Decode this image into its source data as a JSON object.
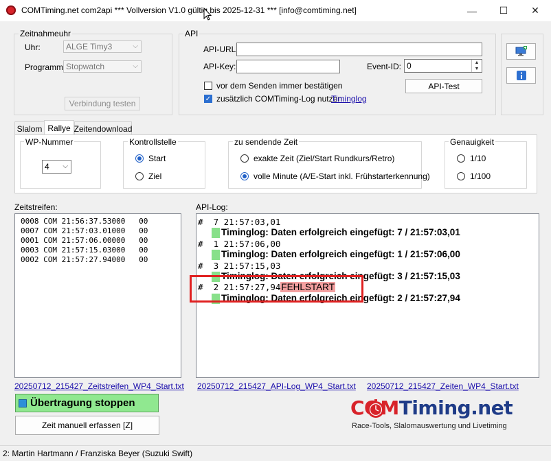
{
  "window": {
    "title": "COMTiming.net com2api *** Vollversion V1.0 gültig bis 2025-12-31 *** [info@comtiming.net]",
    "minimize": "—",
    "maximize": "☐",
    "close": "✕"
  },
  "zeitnahmeuhr": {
    "legend": "Zeitnahmeuhr",
    "uhr_label": "Uhr:",
    "uhr_value": "ALGE Timy3",
    "programm_label": "Programm:",
    "programm_value": "Stopwatch",
    "test_button": "Verbindung testen"
  },
  "api": {
    "legend": "API",
    "url_label": "API-URL:",
    "url_value": "",
    "key_label": "API-Key:",
    "key_value": "",
    "event_label": "Event-ID:",
    "event_value": "0",
    "confirm_label": "vor dem Senden immer bestätigen",
    "confirm_checked": false,
    "log_label": "zusätzlich COMTiming-Log nutzen",
    "log_checked": true,
    "timinglog_link": "Timinglog",
    "test_button": "API-Test"
  },
  "side_buttons": {
    "monitor_icon": "monitor-plus-icon",
    "info_icon": "info-icon"
  },
  "tabs": [
    {
      "label": "Slalom",
      "selected": false
    },
    {
      "label": "Rallye",
      "selected": true
    },
    {
      "label": "Zeitendownload",
      "selected": false
    }
  ],
  "wp": {
    "legend": "WP-Nummer",
    "value": "4"
  },
  "kontrollstelle": {
    "legend": "Kontrollstelle",
    "options": [
      {
        "label": "Start",
        "selected": true
      },
      {
        "label": "Ziel",
        "selected": false
      }
    ]
  },
  "zeit": {
    "legend": "zu sendende Zeit",
    "options": [
      {
        "label": "exakte Zeit (Ziel/Start Rundkurs/Retro)",
        "selected": false
      },
      {
        "label": "volle Minute (A/E-Start inkl. Frühstarterkennung)",
        "selected": true
      }
    ]
  },
  "genauigkeit": {
    "legend": "Genauigkeit",
    "options": [
      {
        "label": "1/10",
        "selected": false
      },
      {
        "label": "1/100",
        "selected": false
      }
    ]
  },
  "zeitstreifen": {
    "label": "Zeitstreifen:",
    "rows": [
      "0008 COM 21:56:37.53000   00",
      "0007 COM 21:57:03.01000   00",
      "0001 COM 21:57:06.00000   00",
      "0003 COM 21:57:15.03000   00",
      "0002 COM 21:57:27.94000   00"
    ],
    "file_link": "20250712_215427_Zeitstreifen_WP4_Start.txt"
  },
  "apilog": {
    "label": "API-Log:",
    "entries": [
      {
        "line": "#  7 21:57:03,01",
        "flag": "",
        "msg": "Timinglog: Daten erfolgreich eingefügt: 7 / 21:57:03,01"
      },
      {
        "line": "#  1 21:57:06,00",
        "flag": "",
        "msg": "Timinglog: Daten erfolgreich eingefügt: 1 / 21:57:06,00"
      },
      {
        "line": "#  3 21:57:15,03",
        "flag": "",
        "msg": "Timinglog: Daten erfolgreich eingefügt: 3 / 21:57:15,03"
      },
      {
        "line": "#  2 21:57:27,94",
        "flag": "FEHLSTART",
        "msg": "Timinglog: Daten erfolgreich eingefügt: 2 / 21:57:27,94"
      }
    ],
    "file_link": "20250712_215427_API-Log_WP4_Start.txt",
    "zeiten_link": "20250712_215427_Zeiten_WP4_Start.txt"
  },
  "buttons": {
    "stop": "Übertragung stoppen",
    "manual": "Zeit manuell erfassen [Z]"
  },
  "logo": {
    "com": "COM",
    "rest": "Timing.net",
    "tagline": "Race-Tools, Slalomauswertung und Livetiming",
    "color_red": "#d8232a",
    "color_blue": "#1f3c88"
  },
  "status": {
    "text": "2: Martin  Hartmann / Franziska  Beyer (Suzuki  Swift)"
  }
}
